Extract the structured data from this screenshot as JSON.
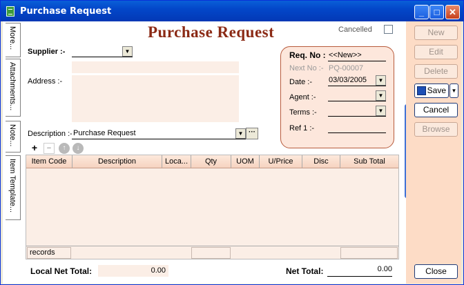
{
  "window": {
    "title": "Purchase Request"
  },
  "title_buttons": {
    "minimize": "_",
    "maximize": "□",
    "close": "✕"
  },
  "side_tabs": [
    "More...",
    "Attachments...",
    "Note...",
    "Item Template..."
  ],
  "header": {
    "title": "Purchase Request",
    "cancelled_label": "Cancelled"
  },
  "form": {
    "supplier_label": "Supplier :-",
    "supplier_value": "",
    "address_label": "Address :-",
    "description_label": "Description :-",
    "description_value": "Purchase Request",
    "description_more": "···"
  },
  "request": {
    "req_no_label": "Req. No :",
    "req_no_value": "<<New>>",
    "next_no_label": "Next No :-",
    "next_no_value": "PQ-00007",
    "date_label": "Date :-",
    "date_value": "03/03/2005",
    "agent_label": "Agent :-",
    "agent_value": "",
    "terms_label": "Terms :-",
    "terms_value": "",
    "ref1_label": "Ref 1 :-",
    "ref1_value": ""
  },
  "item_toolbar": {
    "add": "+",
    "remove": "−",
    "up": "↑",
    "down": "↓"
  },
  "grid": {
    "columns": [
      "Item Code",
      "Description",
      "Loca...",
      "Qty",
      "UOM",
      "U/Price",
      "Disc",
      "Sub Total"
    ],
    "rows": [],
    "footer_records": "records"
  },
  "totals": {
    "local_net_total_label": "Local Net Total:",
    "local_net_total_value": "0.00",
    "net_total_label": "Net Total:",
    "net_total_value": "0.00"
  },
  "actions": {
    "new": "New",
    "edit": "Edit",
    "delete": "Delete",
    "save": "Save",
    "cancel": "Cancel",
    "browse": "Browse",
    "close": "Close"
  },
  "colors": {
    "accent": "#8b2a15",
    "panel": "#fde7dc",
    "side": "#fddcc6",
    "titlebar": "#0347c9"
  }
}
